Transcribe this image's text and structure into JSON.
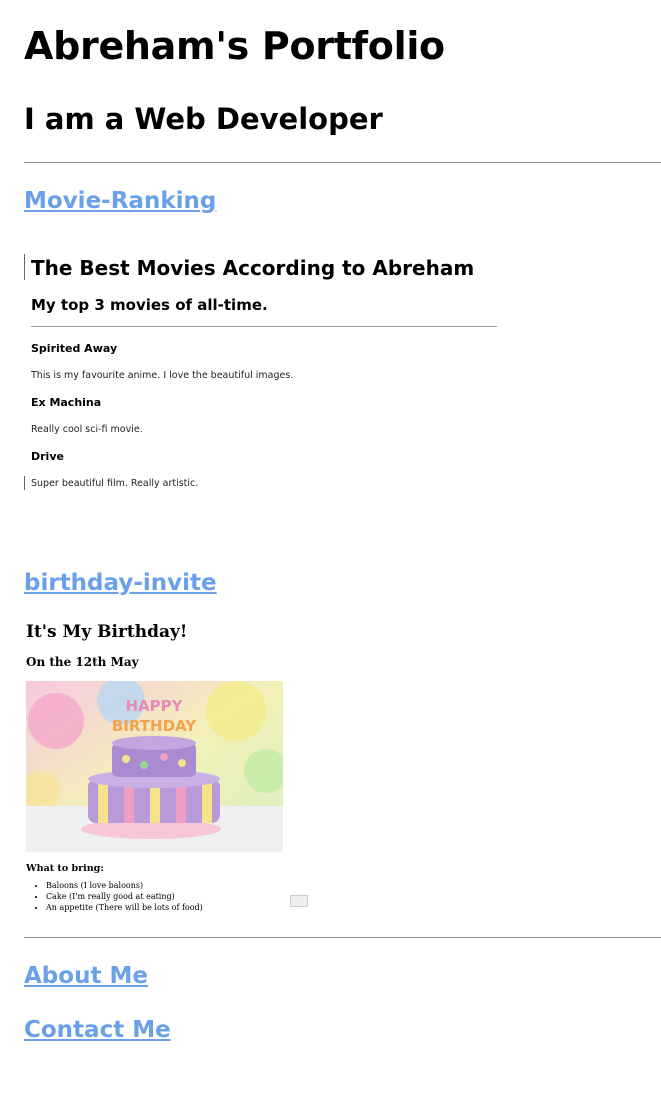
{
  "header": {
    "title": "Abreham's Portfolio",
    "subtitle": "I am a Web Developer"
  },
  "projects": [
    {
      "link": "Movie-Ranking",
      "preview": {
        "heading": "The Best Movies According to Abreham",
        "subheading": "My top 3 movies of all-time.",
        "movies": [
          {
            "title": "Spirited Away",
            "description": "This is my favourite anime. I love the beautiful images."
          },
          {
            "title": "Ex Machina",
            "description": "Really cool sci-fi movie."
          },
          {
            "title": "Drive",
            "description": "Super beautiful film. Really artistic."
          }
        ]
      }
    },
    {
      "link": "birthday-invite",
      "preview": {
        "heading": "It's My Birthday!",
        "subheading": "On the 12th May",
        "image_alt": "birthday-cake-image",
        "bring_heading": "What to bring:",
        "bring_items": [
          "Baloons (I love baloons)",
          "Cake (I'm really good at eating)",
          "An appetite (There will be lots of food)"
        ]
      }
    }
  ],
  "footer_links": {
    "about": "About Me",
    "contact": "Contact Me"
  },
  "colors": {
    "link": "#6aa0e8",
    "rule": "#8c8c8c"
  }
}
